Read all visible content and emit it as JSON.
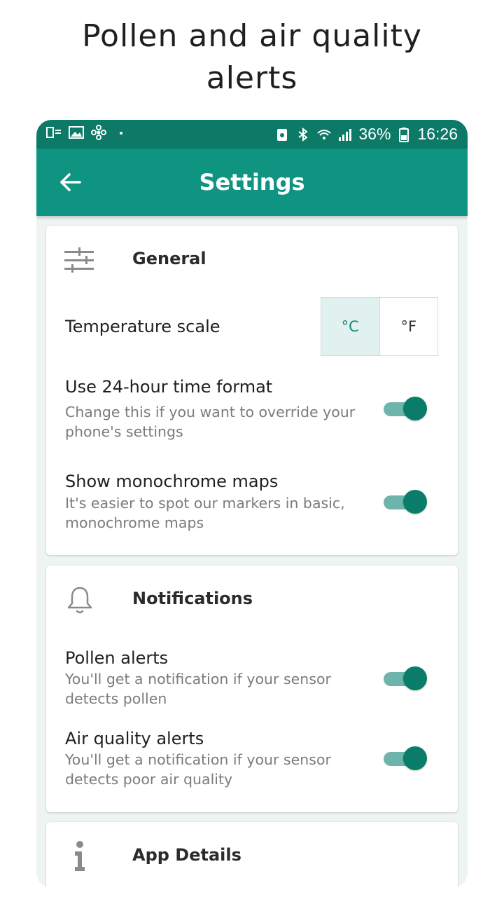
{
  "promo": {
    "title": "Pollen and air quality\nalerts"
  },
  "status_bar": {
    "battery": "36%",
    "time": "16:26",
    "left_icons": [
      "sim-icon",
      "image-icon",
      "fan-icon",
      "dot-icon"
    ],
    "right_icons": [
      "battery-saver-icon",
      "bluetooth-icon",
      "wifi-icon",
      "signal-icon",
      "battery-icon"
    ]
  },
  "app_bar": {
    "title": "Settings",
    "back_icon": "arrow-left-icon"
  },
  "general": {
    "title": "General",
    "icon": "sliders-icon",
    "temperature": {
      "label": "Temperature scale",
      "options": [
        "°C",
        "°F"
      ],
      "selected": "°C"
    },
    "time_format": {
      "title": "Use 24-hour time format",
      "subtitle": "Change this if you want to override your phone's settings",
      "enabled": true
    },
    "monochrome": {
      "title": "Show monochrome maps",
      "subtitle": "It's easier to spot our markers in basic, monochrome maps",
      "enabled": true
    }
  },
  "notifications": {
    "title": "Notifications",
    "icon": "bell-icon",
    "pollen": {
      "title": "Pollen alerts",
      "subtitle": "You'll get a notification if your sensor detects pollen",
      "enabled": true
    },
    "air_quality": {
      "title": "Air quality alerts",
      "subtitle": "You'll get a notification if your sensor detects poor air quality",
      "enabled": true
    }
  },
  "app_details": {
    "title": "App Details",
    "icon": "info-icon"
  },
  "colors": {
    "status_bar": "#0d7a68",
    "app_bar": "#0f9482",
    "accent": "#0a7d6a",
    "toggle_track": "#6db5aa"
  }
}
